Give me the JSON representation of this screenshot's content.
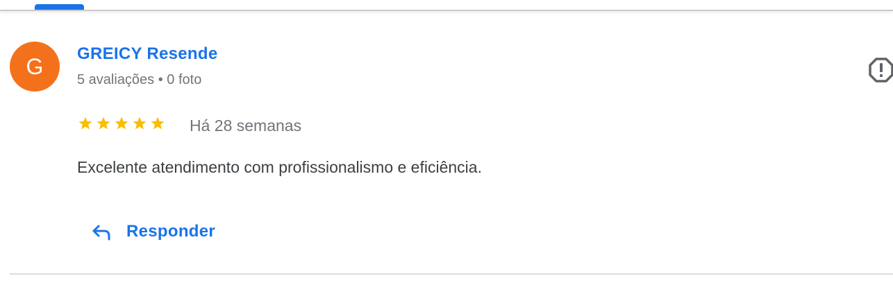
{
  "colors": {
    "link_blue": "#1a73e8",
    "avatar_orange": "#f4711b",
    "star_yellow": "#fbbc04",
    "meta_gray": "#70757a",
    "text_dark": "#3c4043",
    "report_icon_gray": "#5f6368"
  },
  "review": {
    "reviewer": {
      "avatar_letter": "G",
      "name": "GREICY Resende",
      "meta": "5 avaliações • 0 foto"
    },
    "rating": 5,
    "rating_max": 5,
    "date": "Há 28 semanas",
    "text": "Excelente atendimento com profissionalismo e eficiência.",
    "report_icon": "report-flag-icon"
  },
  "actions": {
    "reply_label": "Responder",
    "reply_icon": "reply-arrow-icon"
  }
}
